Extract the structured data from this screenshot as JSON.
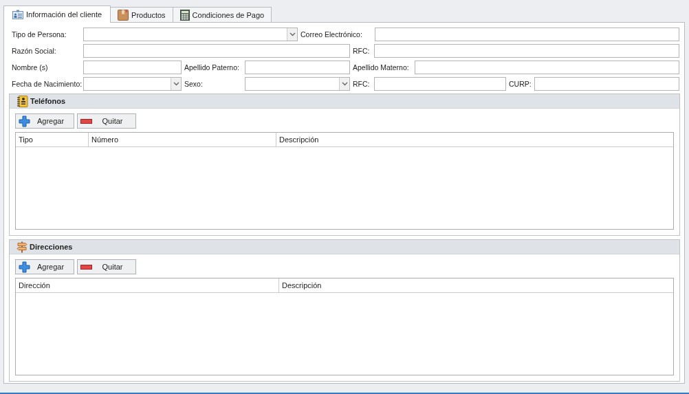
{
  "tabs": [
    {
      "label": "Información del cliente",
      "selected": true
    },
    {
      "label": "Productos",
      "selected": false
    },
    {
      "label": "Condiciones de Pago",
      "selected": false
    }
  ],
  "form": {
    "rows": [
      [
        {
          "label": "Tipo de Persona:",
          "kind": "dropdown"
        },
        {
          "label": "Correo Electrónico:",
          "kind": "text"
        }
      ],
      [
        {
          "label": "Razón Social:",
          "kind": "text"
        },
        {
          "label": "RFC:",
          "kind": "text"
        }
      ],
      [
        {
          "label": "Nombre (s)",
          "kind": "text"
        },
        {
          "label": "Apellido Paterno:",
          "kind": "text"
        },
        {
          "label": "Apellido Materno:",
          "kind": "text"
        }
      ],
      [
        {
          "label": "Fecha de Nacimiento:",
          "kind": "dropdown"
        },
        {
          "label": "Sexo:",
          "kind": "dropdown"
        },
        {
          "label": "RFC:",
          "kind": "text"
        },
        {
          "label": "CURP:",
          "kind": "text"
        }
      ]
    ]
  },
  "groups": [
    {
      "title": "Teléfonos",
      "buttons": [
        "Agregar",
        "Quitar"
      ],
      "columns": [
        "Tipo",
        "Número",
        "Descripción"
      ]
    },
    {
      "title": "Direcciones",
      "buttons": [
        "Agregar",
        "Quitar"
      ],
      "columns": [
        "Dirección",
        "Descripción"
      ]
    }
  ]
}
